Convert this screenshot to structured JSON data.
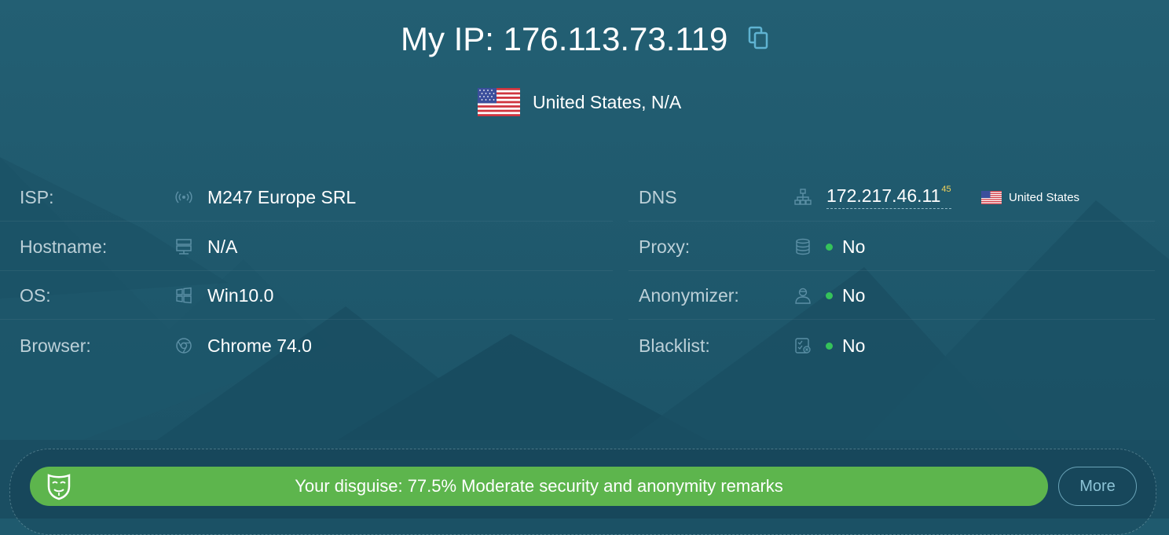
{
  "header": {
    "ip_label": "My IP:",
    "ip_value": "176.113.73.119",
    "location": "United States, N/A"
  },
  "left_rows": [
    {
      "label": "ISP:",
      "icon": "signal-icon",
      "value": "M247 Europe SRL"
    },
    {
      "label": "Hostname:",
      "icon": "server-icon",
      "value": "N/A"
    },
    {
      "label": "OS:",
      "icon": "windows-icon",
      "value": "Win10.0"
    },
    {
      "label": "Browser:",
      "icon": "chrome-icon",
      "value": "Chrome 74.0"
    }
  ],
  "right_rows": [
    {
      "label": "DNS",
      "icon": "network-icon",
      "ip": "172.217.46.11",
      "sup": "45",
      "country": "United States"
    },
    {
      "label": "Proxy:",
      "icon": "database-icon",
      "value": "No",
      "status": "green"
    },
    {
      "label": "Anonymizer:",
      "icon": "user-icon",
      "value": "No",
      "status": "green"
    },
    {
      "label": "Blacklist:",
      "icon": "checklist-icon",
      "value": "No",
      "status": "green"
    }
  ],
  "disguise": {
    "text": "Your disguise: 77.5% Moderate security and anonymity remarks",
    "percent": 77.5,
    "more_label": "More"
  },
  "colors": {
    "background": "#1f5a6e",
    "disguise_bar": "#5db54d",
    "status_dot": "#35c25a",
    "label": "#bcd0d8",
    "accent": "#8cc3d6"
  }
}
